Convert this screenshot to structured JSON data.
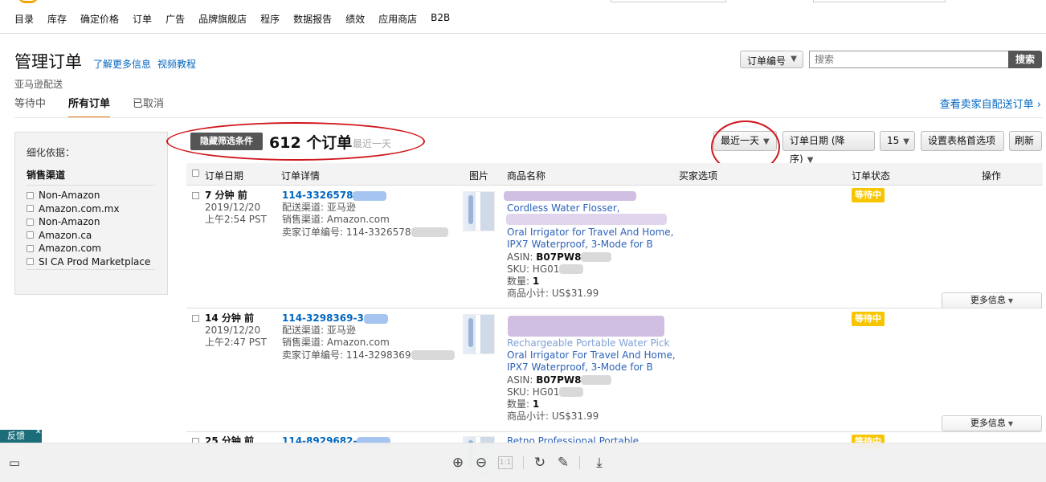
{
  "nav": [
    "目录",
    "库存",
    "确定价格",
    "订单",
    "广告",
    "品牌旗舰店",
    "程序",
    "数据报告",
    "绩效",
    "应用商店",
    "B2B"
  ],
  "header": {
    "title": "管理订单",
    "learn_more": "了解更多信息",
    "video": "视频教程",
    "subtitle": "亚马逊配送"
  },
  "tabs": [
    "等待中",
    "所有订单",
    "已取消"
  ],
  "self_fulfilled_link": "查看卖家自配送订单 ›",
  "search": {
    "field_select": "订单编号",
    "placeholder": "搜索",
    "button": "搜索"
  },
  "sidebar": {
    "title": "细化依据：",
    "section": "销售渠道",
    "items": [
      "Non-Amazon",
      "Amazon.com.mx",
      "Non-Amazon",
      "Amazon.ca",
      "Amazon.com",
      "SI CA Prod Marketplace"
    ]
  },
  "results": {
    "hide_filters": "隐藏筛选条件",
    "count": "612 个订单",
    "range_note": "最近一天",
    "date_range": "最近一天",
    "sort": "订单日期 (降序)",
    "per_page": "15",
    "table_prefs": "设置表格首选项",
    "refresh": "刷新"
  },
  "table": {
    "headers": [
      "订单日期",
      "订单详情",
      "图片",
      "商品名称",
      "买家选项",
      "订单状态",
      "操作"
    ]
  },
  "orders": [
    {
      "age": "7 分钟 前",
      "date": "2019/12/20",
      "time": "上午2:54 PST",
      "order_id": "114-3326578",
      "channel": "配送渠道: 亚马逊",
      "sales_channel": "销售渠道: Amazon.com",
      "seller_order": "卖家订单编号: 114-3326578",
      "product_lines": [
        "Cordless Water Flosser,",
        "Oral Irrigator for Travel And Home,",
        "IPX7 Waterproof, 3-Mode for B"
      ],
      "asin_label": "ASIN:",
      "asin": "B07PW8",
      "sku": "SKU: HG01",
      "qty_label": "数量:",
      "qty": "1",
      "subtotal": "商品小计: US$31.99",
      "status": "等待中",
      "more": "更多信息"
    },
    {
      "age": "14 分钟 前",
      "date": "2019/12/20",
      "time": "上午2:47 PST",
      "order_id": "114-3298369-3",
      "channel": "配送渠道: 亚马逊",
      "sales_channel": "销售渠道: Amazon.com",
      "seller_order": "卖家订单编号: 114-3298369",
      "product_lines": [
        "Rechargeable Portable Water Pick",
        "Oral Irrigator For Travel And Home,",
        "IPX7 Waterproof, 3-Mode for B"
      ],
      "asin_label": "ASIN:",
      "asin": "B07PW8",
      "sku": "SKU: HG01",
      "qty_label": "数量:",
      "qty": "1",
      "subtotal": "商品小计: US$31.99",
      "status": "等待中",
      "more": "更多信息"
    },
    {
      "age": "25 分钟 前",
      "order_id": "114-8929682-",
      "product_lines": [
        "Retno Professional Portable"
      ],
      "status": "等待中"
    }
  ],
  "feedback": "反馈",
  "viewer": {
    "page": "1:1"
  },
  "colors": {
    "link": "#0066c0",
    "badge": "#f7c500",
    "annotation": "#d0161d",
    "tab_active": "#e47911"
  }
}
